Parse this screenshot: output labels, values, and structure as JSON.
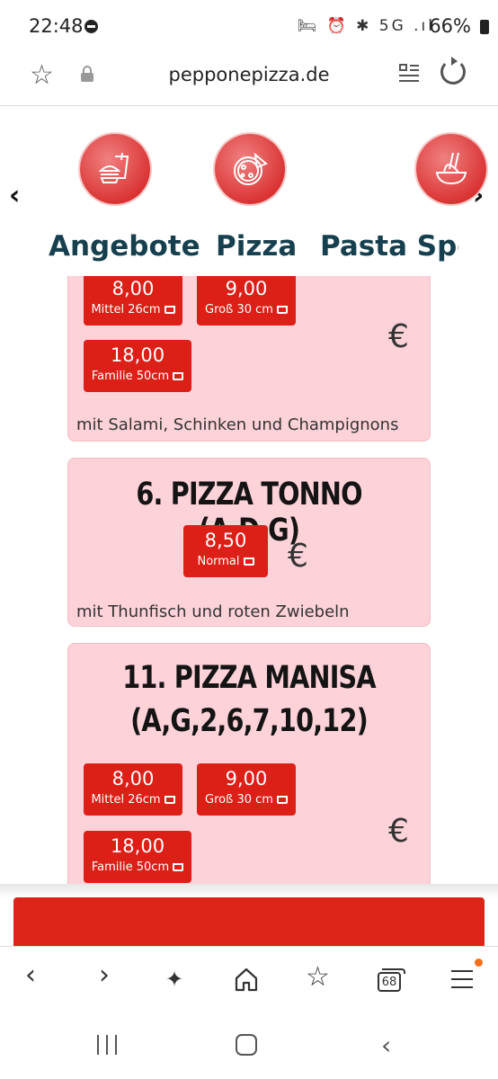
{
  "status_bar": {
    "time": "22:48",
    "icons": "🛏 ⏰ ✱ 5G .ıl",
    "battery": "66%"
  },
  "url_bar": {
    "url": "pepponepizza.de"
  },
  "categories": [
    {
      "label": "Angebote",
      "icon": "burger-drink-icon"
    },
    {
      "label": "Pizza",
      "icon": "pizza-icon"
    },
    {
      "label": "Pasta Spez",
      "icon": "pasta-icon"
    }
  ],
  "currency": "€",
  "cards": [
    {
      "title": "",
      "prices": [
        {
          "price": "8,00",
          "size": "Mittel 26cm"
        },
        {
          "price": "9,00",
          "size": "Groß 30 cm"
        },
        {
          "price": "18,00",
          "size": "Familie 50cm"
        }
      ],
      "description": "mit Salami, Schinken und Champignons"
    },
    {
      "title": "6. PIZZA TONNO (A,D,G)",
      "prices": [
        {
          "price": "8,50",
          "size": "Normal"
        }
      ],
      "description": "mit Thunfisch und roten Zwiebeln"
    },
    {
      "title_line1": "11. PIZZA MANISA",
      "title_line2": "(A,G,2,6,7,10,12)",
      "prices": [
        {
          "price": "8,00",
          "size": "Mittel 26cm"
        },
        {
          "price": "9,00",
          "size": "Groß 30 cm"
        },
        {
          "price": "18,00",
          "size": "Familie 50cm"
        }
      ]
    }
  ],
  "toolbar": {
    "tab_count": "68"
  },
  "colors": {
    "price_button": "#dc1f17",
    "card_bg": "#fdd2d8",
    "category_text": "#17404f",
    "banner": "#dc2418"
  }
}
